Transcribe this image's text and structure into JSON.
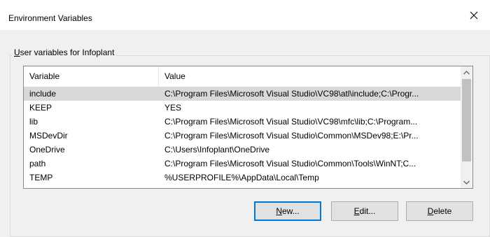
{
  "window": {
    "title": "Environment Variables"
  },
  "group": {
    "legend_mnemonic": "U",
    "legend_rest": "ser variables for Infoplant"
  },
  "table": {
    "headers": [
      "Variable",
      "Value"
    ],
    "rows": [
      {
        "variable": "include",
        "value": "C:\\Program Files\\Microsoft Visual Studio\\VC98\\atl\\include;C:\\Progr...",
        "selected": true
      },
      {
        "variable": "KEEP",
        "value": "YES",
        "selected": false
      },
      {
        "variable": "lib",
        "value": "C:\\Program Files\\Microsoft Visual Studio\\VC98\\mfc\\lib;C:\\Program...",
        "selected": false
      },
      {
        "variable": "MSDevDir",
        "value": "C:\\Program Files\\Microsoft Visual Studio\\Common\\MSDev98;E:\\Pr...",
        "selected": false
      },
      {
        "variable": "OneDrive",
        "value": "C:\\Users\\Infoplant\\OneDrive",
        "selected": false
      },
      {
        "variable": "path",
        "value": "C:\\Program Files\\Microsoft Visual Studio\\Common\\Tools\\WinNT;C...",
        "selected": false
      },
      {
        "variable": "TEMP",
        "value": "%USERPROFILE%\\AppData\\Local\\Temp",
        "selected": false
      }
    ]
  },
  "buttons": {
    "new": {
      "mnemonic": "N",
      "rest": "ew..."
    },
    "edit": {
      "mnemonic": "E",
      "rest": "dit..."
    },
    "delete": {
      "mnemonic": "D",
      "rest": "elete"
    }
  },
  "icons": {
    "close": "close-icon",
    "scroll_up": "chevron-up-icon",
    "scroll_down": "chevron-down-icon"
  },
  "colors": {
    "selected_row": "#d9d9d9",
    "default_button_border": "#0078d7",
    "dialog_background": "#f0f0f0"
  }
}
